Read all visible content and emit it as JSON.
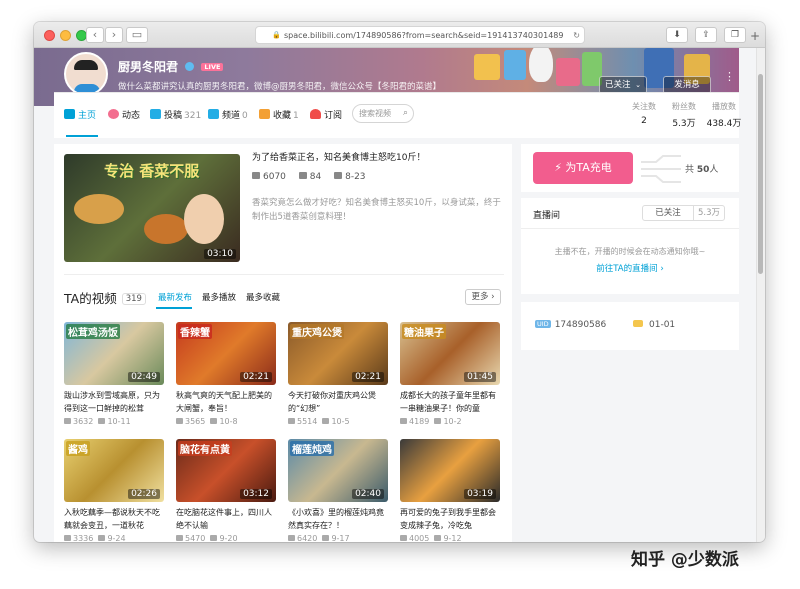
{
  "browser": {
    "url": "space.bilibili.com/174890586?from=search&seid=191413740301489",
    "tab_plus": "+"
  },
  "profile": {
    "name": "厨男冬阳君",
    "live_badge": "LIVE",
    "sign": "做什么菜都讲究认真的厨男冬阳君，微博@厨男冬阳君，微信公众号【冬阳君的菜谱】",
    "follow_label": "已关注",
    "message_label": "发消息"
  },
  "nav": {
    "tabs": [
      {
        "label": "主页",
        "count": ""
      },
      {
        "label": "动态",
        "count": ""
      },
      {
        "label": "投稿",
        "count": "321"
      },
      {
        "label": "频道",
        "count": "0"
      },
      {
        "label": "收藏",
        "count": "1"
      },
      {
        "label": "订阅",
        "count": ""
      }
    ],
    "search_placeholder": "搜索视频",
    "stats": [
      {
        "label": "关注数",
        "value": "2"
      },
      {
        "label": "粉丝数",
        "value": "5.3万"
      },
      {
        "label": "播放数",
        "value": "438.4万"
      }
    ]
  },
  "rep_video": {
    "cover_text": "专治 香菜不服",
    "duration": "03:10",
    "title": "为了给香菜正名，知名美食博主怒吃10斤！",
    "plays": "6070",
    "danmaku": "84",
    "date": "8-23",
    "desc": "香菜究竟怎么做才好吃？知名美食博主怒买10斤，以身试菜，终于制作出5道香菜创意料理！"
  },
  "videos_section": {
    "title": "TA的视频",
    "count": "319",
    "tabs": [
      "最新发布",
      "最多播放",
      "最多收藏"
    ],
    "more": "更多"
  },
  "videos": [
    {
      "cover": "松茸鸡汤饭",
      "duration": "02:49",
      "title": "跋山涉水到雪域高原，只为得到这一口鲜掉的松茸",
      "plays": "3632",
      "date": "10-11"
    },
    {
      "cover": "香辣蟹",
      "duration": "02:21",
      "title": "秋高气爽的天气配上肥美的大闸蟹，奉旨！",
      "plays": "3565",
      "date": "10-8"
    },
    {
      "cover": "重庆鸡公煲",
      "duration": "02:21",
      "title": "今天打破你对重庆鸡公煲的“幻想”",
      "plays": "5514",
      "date": "10-5"
    },
    {
      "cover": "糖油果子",
      "duration": "01:45",
      "title": "成都长大的孩子童年里都有一串糖油果子！你的童",
      "plays": "4189",
      "date": "10-2"
    },
    {
      "cover": "酱鸡",
      "duration": "02:26",
      "title": "入秋吃藕季—都说秋天不吃藕就会变丑，一道秋花",
      "plays": "3336",
      "date": "9-24"
    },
    {
      "cover": "脑花有点黄",
      "duration": "03:12",
      "title": "在吃脑花这件事上，四川人绝不认输",
      "plays": "5470",
      "date": "9-20"
    },
    {
      "cover": "榴莲炖鸡",
      "duration": "02:40",
      "title": "《小欢喜》里的榴莲炖鸡竟然真实存在？！",
      "plays": "6420",
      "date": "9-17"
    },
    {
      "cover": "",
      "duration": "03:19",
      "title": "再可爱的兔子到我手里都会变成辣子兔，冷吃兔",
      "plays": "4005",
      "date": "9-12"
    }
  ],
  "charge": {
    "label": "为TA充电",
    "count_prefix": "共",
    "count": "50",
    "count_suffix": "人"
  },
  "live": {
    "title": "直播间",
    "followed_label": "已关注",
    "followed_count": "5.3万",
    "status": "主播不在，开播的时候会在动态通知你哦~",
    "link": "前往TA的直播间"
  },
  "info": {
    "uid_badge": "UID",
    "uid": "174890586",
    "birthday": "01-01"
  },
  "watermark": "知乎 @少数派",
  "colors": {
    "accent": "#00a1d6",
    "charge": "#f25d8e",
    "live_badge": "#fb7299"
  }
}
